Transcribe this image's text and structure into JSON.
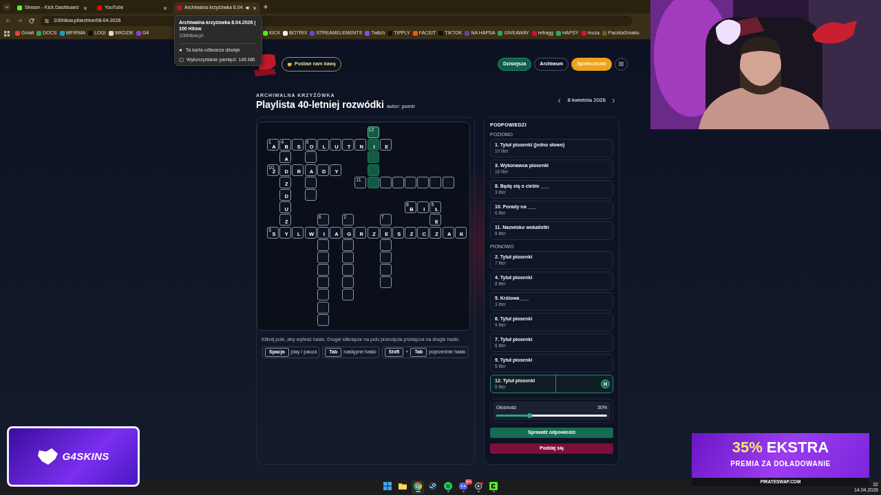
{
  "browser": {
    "tabs": [
      {
        "title": "Stream - Kick Dashboard",
        "color": "#53fc18",
        "selected": false,
        "audio": false
      },
      {
        "title": "YouTube",
        "color": "#ff0000",
        "selected": false,
        "audio": false
      },
      {
        "title": "Archiwalna krzyżówka 8.04",
        "color": "#c0102a",
        "selected": true,
        "audio": true
      }
    ],
    "url": "100hitow.pl/archive/08-04-2026",
    "bookmark_groups": [
      [
        {
          "label": "Gmail",
          "color": "#ea4335"
        },
        {
          "label": "DOCS",
          "color": "#34a853"
        },
        {
          "label": "WFIRMA",
          "color": "#1aa0c8"
        },
        {
          "label": "LOGI",
          "color": "#111111"
        },
        {
          "label": "WKDZIK",
          "color": "#dddddd"
        },
        {
          "label": "G4",
          "color": "#8b3fd9"
        }
      ],
      [
        {
          "label": "KICK",
          "color": "#53fc18"
        },
        {
          "label": "BOTRIX",
          "color": "#eeeeee"
        },
        {
          "label": "STREAMELEMENTS",
          "color": "#5b4bd6"
        },
        {
          "label": "Twitch",
          "color": "#9146ff"
        },
        {
          "label": "TIPPLY",
          "color": "#111111"
        },
        {
          "label": "FACEIT",
          "color": "#ff5500"
        },
        {
          "label": "TIKTOK",
          "color": "#111111"
        },
        {
          "label": "NA HAPSA",
          "color": "#6b3fa0"
        },
        {
          "label": "GIVEAWAY",
          "color": "#34a853"
        },
        {
          "label": "refragg",
          "color": "#d0103a"
        },
        {
          "label": "HAPSY",
          "color": "#34a853"
        },
        {
          "label": "muza",
          "color": "#e0102a"
        },
        {
          "label": "PaczkaSmaku",
          "color": "#6b5a2a"
        }
      ]
    ],
    "tooltip": {
      "title": "Archiwalna krzyżówka 8.04.2026 | 100 Hitów",
      "domain": "100hitow.pl",
      "details": [
        "Ta karta odtwarza dźwięk",
        "Wykorzystanie pamięci: 146 MB"
      ]
    }
  },
  "site": {
    "coffee_button": "Postaw nam kawę",
    "nav": [
      {
        "label": "Dzisiejsza",
        "kind": "today"
      },
      {
        "label": "Archiwum",
        "kind": "archive"
      },
      {
        "label": "Społeczność",
        "kind": "community"
      }
    ]
  },
  "puzzle": {
    "eyebrow": "ARCHIWALNA KRZYŻÓWKA",
    "title": "Playlista 40-letniej rozwódki",
    "author": "autor: pomir",
    "date": "8 kwietnia 2026",
    "grid": [
      [
        {
          "kind": "blank"
        },
        {
          "kind": "blank"
        },
        {
          "kind": "blank"
        },
        {
          "kind": "blank"
        },
        {
          "kind": "blank"
        },
        {
          "kind": "blank"
        },
        {
          "kind": "blank"
        },
        {
          "kind": "blank"
        },
        {
          "kind": "square",
          "number": "12",
          "active": true,
          "selected": true
        },
        {
          "kind": "blank"
        },
        {
          "kind": "blank"
        },
        {
          "kind": "blank"
        },
        {
          "kind": "blank"
        },
        {
          "kind": "blank"
        },
        {
          "kind": "blank"
        },
        {
          "kind": "blank"
        }
      ],
      [
        {
          "kind": "square",
          "letter": "A",
          "number": "1",
          "active": false,
          "selected": false
        },
        {
          "kind": "square",
          "letter": "B",
          "number": "4",
          "active": false,
          "selected": false
        },
        {
          "kind": "square",
          "letter": "S",
          "active": false,
          "selected": false
        },
        {
          "kind": "square",
          "letter": "O",
          "number": "9",
          "active": false,
          "selected": false
        },
        {
          "kind": "square",
          "letter": "L",
          "active": false,
          "selected": false
        },
        {
          "kind": "square",
          "letter": "U",
          "active": false,
          "selected": false
        },
        {
          "kind": "square",
          "letter": "T",
          "active": false,
          "selected": false
        },
        {
          "kind": "square",
          "letter": "N",
          "active": false,
          "selected": false
        },
        {
          "kind": "square",
          "letter": "I",
          "active": true,
          "selected": false
        },
        {
          "kind": "square",
          "letter": "E",
          "active": false,
          "selected": false
        },
        {
          "kind": "blank"
        },
        {
          "kind": "blank"
        },
        {
          "kind": "blank"
        },
        {
          "kind": "blank"
        },
        {
          "kind": "blank"
        },
        {
          "kind": "blank"
        }
      ],
      [
        {
          "kind": "blank"
        },
        {
          "kind": "square",
          "letter": "A",
          "active": false,
          "selected": false
        },
        {
          "kind": "blank"
        },
        {
          "kind": "square",
          "active": false,
          "selected": false
        },
        {
          "kind": "blank"
        },
        {
          "kind": "blank"
        },
        {
          "kind": "blank"
        },
        {
          "kind": "blank"
        },
        {
          "kind": "square",
          "active": true,
          "selected": false
        },
        {
          "kind": "blank"
        },
        {
          "kind": "blank"
        },
        {
          "kind": "blank"
        },
        {
          "kind": "blank"
        },
        {
          "kind": "blank"
        },
        {
          "kind": "blank"
        },
        {
          "kind": "blank"
        }
      ],
      [
        {
          "kind": "square",
          "letter": "Ż",
          "number": "10",
          "active": false,
          "selected": false
        },
        {
          "kind": "square",
          "letter": "D",
          "active": false,
          "selected": false
        },
        {
          "kind": "square",
          "letter": "R",
          "active": false,
          "selected": false
        },
        {
          "kind": "square",
          "letter": "A",
          "active": false,
          "selected": false
        },
        {
          "kind": "square",
          "letter": "D",
          "active": false,
          "selected": false
        },
        {
          "kind": "square",
          "letter": "Y",
          "active": false,
          "selected": false
        },
        {
          "kind": "blank"
        },
        {
          "kind": "blank"
        },
        {
          "kind": "square",
          "active": true,
          "selected": false
        },
        {
          "kind": "blank"
        },
        {
          "kind": "blank"
        },
        {
          "kind": "blank"
        },
        {
          "kind": "blank"
        },
        {
          "kind": "blank"
        },
        {
          "kind": "blank"
        },
        {
          "kind": "blank"
        }
      ],
      [
        {
          "kind": "blank"
        },
        {
          "kind": "square",
          "letter": "Z",
          "active": false,
          "selected": false
        },
        {
          "kind": "blank"
        },
        {
          "kind": "square",
          "active": false,
          "selected": false
        },
        {
          "kind": "blank"
        },
        {
          "kind": "blank"
        },
        {
          "kind": "blank"
        },
        {
          "kind": "square",
          "number": "11",
          "active": false,
          "selected": false
        },
        {
          "kind": "square",
          "active": true,
          "selected": false
        },
        {
          "kind": "square",
          "active": false,
          "selected": false
        },
        {
          "kind": "square",
          "active": false,
          "selected": false
        },
        {
          "kind": "square",
          "active": false,
          "selected": false
        },
        {
          "kind": "square",
          "active": false,
          "selected": false
        },
        {
          "kind": "square",
          "active": false,
          "selected": false
        },
        {
          "kind": "square",
          "active": false,
          "selected": false
        },
        {
          "kind": "blank"
        }
      ],
      [
        {
          "kind": "blank"
        },
        {
          "kind": "square",
          "letter": "D",
          "active": false,
          "selected": false
        },
        {
          "kind": "blank"
        },
        {
          "kind": "square",
          "active": false,
          "selected": false
        },
        {
          "kind": "blank"
        },
        {
          "kind": "blank"
        },
        {
          "kind": "blank"
        },
        {
          "kind": "blank"
        },
        {
          "kind": "blank"
        },
        {
          "kind": "blank"
        },
        {
          "kind": "blank"
        },
        {
          "kind": "blank"
        },
        {
          "kind": "blank"
        },
        {
          "kind": "blank"
        },
        {
          "kind": "blank"
        },
        {
          "kind": "blank"
        }
      ],
      [
        {
          "kind": "blank"
        },
        {
          "kind": "square",
          "letter": "U",
          "active": false,
          "selected": false
        },
        {
          "kind": "blank"
        },
        {
          "kind": "blank"
        },
        {
          "kind": "blank"
        },
        {
          "kind": "blank"
        },
        {
          "kind": "blank"
        },
        {
          "kind": "blank"
        },
        {
          "kind": "blank"
        },
        {
          "kind": "blank"
        },
        {
          "kind": "blank"
        },
        {
          "kind": "square",
          "letter": "B",
          "number": "8",
          "active": false,
          "selected": false
        },
        {
          "kind": "square",
          "letter": "I",
          "active": false,
          "selected": false
        },
        {
          "kind": "square",
          "letter": "Ł",
          "number": "5",
          "active": false,
          "selected": false
        },
        {
          "kind": "blank"
        },
        {
          "kind": "blank"
        }
      ],
      [
        {
          "kind": "blank"
        },
        {
          "kind": "square",
          "letter": "Z",
          "active": false,
          "selected": false
        },
        {
          "kind": "blank"
        },
        {
          "kind": "blank"
        },
        {
          "kind": "square",
          "number": "6",
          "active": false,
          "selected": false
        },
        {
          "kind": "blank"
        },
        {
          "kind": "square",
          "number": "2",
          "active": false,
          "selected": false
        },
        {
          "kind": "blank"
        },
        {
          "kind": "blank"
        },
        {
          "kind": "square",
          "number": "7",
          "active": false,
          "selected": false
        },
        {
          "kind": "blank"
        },
        {
          "kind": "blank"
        },
        {
          "kind": "blank"
        },
        {
          "kind": "square",
          "letter": "E",
          "active": false,
          "selected": false
        },
        {
          "kind": "blank"
        },
        {
          "kind": "blank"
        }
      ],
      [
        {
          "kind": "square",
          "letter": "S",
          "number": "3",
          "active": false,
          "selected": false
        },
        {
          "kind": "square",
          "letter": "Y",
          "active": false,
          "selected": false
        },
        {
          "kind": "square",
          "letter": "L",
          "active": false,
          "selected": false
        },
        {
          "kind": "square",
          "letter": "W",
          "active": false,
          "selected": false
        },
        {
          "kind": "square",
          "letter": "I",
          "active": false,
          "selected": false
        },
        {
          "kind": "square",
          "letter": "A",
          "active": false,
          "selected": false
        },
        {
          "kind": "square",
          "letter": "G",
          "active": false,
          "selected": false
        },
        {
          "kind": "square",
          "letter": "R",
          "active": false,
          "selected": false
        },
        {
          "kind": "square",
          "letter": "Z",
          "active": false,
          "selected": false
        },
        {
          "kind": "square",
          "letter": "E",
          "active": false,
          "selected": false
        },
        {
          "kind": "square",
          "letter": "S",
          "active": false,
          "selected": false
        },
        {
          "kind": "square",
          "letter": "Z",
          "active": false,
          "selected": false
        },
        {
          "kind": "square",
          "letter": "C",
          "active": false,
          "selected": false
        },
        {
          "kind": "square",
          "letter": "Z",
          "active": false,
          "selected": false
        },
        {
          "kind": "square",
          "letter": "A",
          "active": false,
          "selected": false
        },
        {
          "kind": "square",
          "letter": "K",
          "active": false,
          "selected": false
        }
      ],
      [
        {
          "kind": "blank"
        },
        {
          "kind": "blank"
        },
        {
          "kind": "blank"
        },
        {
          "kind": "blank"
        },
        {
          "kind": "square",
          "active": false,
          "selected": false
        },
        {
          "kind": "blank"
        },
        {
          "kind": "square",
          "active": false,
          "selected": false
        },
        {
          "kind": "blank"
        },
        {
          "kind": "blank"
        },
        {
          "kind": "square",
          "active": false,
          "selected": false
        },
        {
          "kind": "blank"
        },
        {
          "kind": "blank"
        },
        {
          "kind": "blank"
        },
        {
          "kind": "blank"
        },
        {
          "kind": "blank"
        },
        {
          "kind": "blank"
        }
      ],
      [
        {
          "kind": "blank"
        },
        {
          "kind": "blank"
        },
        {
          "kind": "blank"
        },
        {
          "kind": "blank"
        },
        {
          "kind": "square",
          "active": false,
          "selected": false
        },
        {
          "kind": "blank"
        },
        {
          "kind": "square",
          "active": false,
          "selected": false
        },
        {
          "kind": "blank"
        },
        {
          "kind": "blank"
        },
        {
          "kind": "square",
          "active": false,
          "selected": false
        },
        {
          "kind": "blank"
        },
        {
          "kind": "blank"
        },
        {
          "kind": "blank"
        },
        {
          "kind": "blank"
        },
        {
          "kind": "blank"
        },
        {
          "kind": "blank"
        }
      ],
      [
        {
          "kind": "blank"
        },
        {
          "kind": "blank"
        },
        {
          "kind": "blank"
        },
        {
          "kind": "blank"
        },
        {
          "kind": "square",
          "active": false,
          "selected": false
        },
        {
          "kind": "blank"
        },
        {
          "kind": "square",
          "active": false,
          "selected": false
        },
        {
          "kind": "blank"
        },
        {
          "kind": "blank"
        },
        {
          "kind": "square",
          "active": false,
          "selected": false
        },
        {
          "kind": "blank"
        },
        {
          "kind": "blank"
        },
        {
          "kind": "blank"
        },
        {
          "kind": "blank"
        },
        {
          "kind": "blank"
        },
        {
          "kind": "blank"
        }
      ],
      [
        {
          "kind": "blank"
        },
        {
          "kind": "blank"
        },
        {
          "kind": "blank"
        },
        {
          "kind": "blank"
        },
        {
          "kind": "square",
          "active": false,
          "selected": false
        },
        {
          "kind": "blank"
        },
        {
          "kind": "square",
          "active": false,
          "selected": false
        },
        {
          "kind": "blank"
        },
        {
          "kind": "blank"
        },
        {
          "kind": "square",
          "active": false,
          "selected": false
        },
        {
          "kind": "blank"
        },
        {
          "kind": "blank"
        },
        {
          "kind": "blank"
        },
        {
          "kind": "blank"
        },
        {
          "kind": "blank"
        },
        {
          "kind": "blank"
        }
      ],
      [
        {
          "kind": "blank"
        },
        {
          "kind": "blank"
        },
        {
          "kind": "blank"
        },
        {
          "kind": "blank"
        },
        {
          "kind": "square",
          "active": false,
          "selected": false
        },
        {
          "kind": "blank"
        },
        {
          "kind": "square",
          "active": false,
          "selected": false
        },
        {
          "kind": "blank"
        },
        {
          "kind": "blank"
        },
        {
          "kind": "blank"
        },
        {
          "kind": "blank"
        },
        {
          "kind": "blank"
        },
        {
          "kind": "blank"
        },
        {
          "kind": "blank"
        },
        {
          "kind": "blank"
        },
        {
          "kind": "blank"
        }
      ],
      [
        {
          "kind": "blank"
        },
        {
          "kind": "blank"
        },
        {
          "kind": "blank"
        },
        {
          "kind": "blank"
        },
        {
          "kind": "square",
          "active": false,
          "selected": false
        },
        {
          "kind": "blank"
        },
        {
          "kind": "blank"
        },
        {
          "kind": "blank"
        },
        {
          "kind": "blank"
        },
        {
          "kind": "blank"
        },
        {
          "kind": "blank"
        },
        {
          "kind": "blank"
        },
        {
          "kind": "blank"
        },
        {
          "kind": "blank"
        },
        {
          "kind": "blank"
        },
        {
          "kind": "blank"
        }
      ],
      [
        {
          "kind": "blank"
        },
        {
          "kind": "blank"
        },
        {
          "kind": "blank"
        },
        {
          "kind": "blank"
        },
        {
          "kind": "square",
          "active": false,
          "selected": false
        },
        {
          "kind": "blank"
        },
        {
          "kind": "blank"
        },
        {
          "kind": "blank"
        },
        {
          "kind": "blank"
        },
        {
          "kind": "blank"
        },
        {
          "kind": "blank"
        },
        {
          "kind": "blank"
        },
        {
          "kind": "blank"
        },
        {
          "kind": "blank"
        },
        {
          "kind": "blank"
        },
        {
          "kind": "blank"
        }
      ]
    ],
    "hint": "Kliknij pole, aby wybrać hasło. Drugie kliknięcie na polu przecięcia przełącza na drugie hasło.",
    "shortcuts": [
      {
        "keys": [
          "Spacja"
        ],
        "action": "play / pauza"
      },
      {
        "keys": [
          "Tab"
        ],
        "action": "następne hasło"
      },
      {
        "keys": [
          "Shift",
          "Tab"
        ],
        "joiner": "+",
        "action": "poprzednie hasło"
      }
    ]
  },
  "clues": {
    "title": "PODPOWIEDZI",
    "groups": [
      {
        "heading": "POZIOMO",
        "items": [
          {
            "text": "1. Tytuł piosenki (jedno słowo)",
            "length": "10 liter",
            "selected": false
          },
          {
            "text": "3. Wykonawca piosenki",
            "length": "16 liter",
            "selected": false
          },
          {
            "text": "8. Będę się o ciebie ___",
            "length": "3 liter",
            "selected": false
          },
          {
            "text": "10. Porady na ___",
            "length": "6 liter",
            "selected": false
          },
          {
            "text": "11. Nazwisko wokalistki",
            "length": "8 liter",
            "selected": false
          }
        ]
      },
      {
        "heading": "PIONOWO",
        "items": [
          {
            "text": "2. Tytuł piosenki",
            "length": "7 liter",
            "selected": false
          },
          {
            "text": "4. Tytuł piosenki",
            "length": "8 liter",
            "selected": false
          },
          {
            "text": "5. Królowa ___",
            "length": "3 liter",
            "selected": false
          },
          {
            "text": "6. Tytuł piosenki",
            "length": "9 liter",
            "selected": false
          },
          {
            "text": "7. Tytuł piosenki",
            "length": "6 liter",
            "selected": false
          },
          {
            "text": "9. Tytuł piosenki",
            "length": "5 liter",
            "selected": false
          },
          {
            "text": "12. Tytuł piosenki",
            "length": "5 liter",
            "selected": true
          }
        ]
      }
    ]
  },
  "volume": {
    "label": "Głośność",
    "reading": "30%",
    "level": 0.3
  },
  "check_button": "Sprawdź odpowiedzi",
  "give_up_button": "Poddaj się",
  "sponsor_badge": {
    "brand": "G4SKINS"
  },
  "promo": {
    "highlight": "35%",
    "headline": "EKSTRA",
    "subline": "PREMIA ZA DOŁADOWANIE",
    "site": "PIRATESWAP.COM"
  },
  "taskbar": {
    "apps": [
      {
        "kind": "start",
        "selected": false,
        "running": false
      },
      {
        "kind": "folder",
        "selected": false,
        "running": false
      },
      {
        "kind": "browser",
        "selected": true,
        "running": true
      },
      {
        "kind": "steam",
        "selected": false,
        "running": false
      },
      {
        "kind": "music",
        "selected": false,
        "running": true
      },
      {
        "kind": "chat",
        "selected": false,
        "running": true,
        "badge": "9+"
      },
      {
        "kind": "recorder",
        "selected": false,
        "running": true,
        "notification": true
      },
      {
        "kind": "kick",
        "selected": false,
        "running": true
      }
    ],
    "time": "32",
    "date": "14.04.2026"
  }
}
